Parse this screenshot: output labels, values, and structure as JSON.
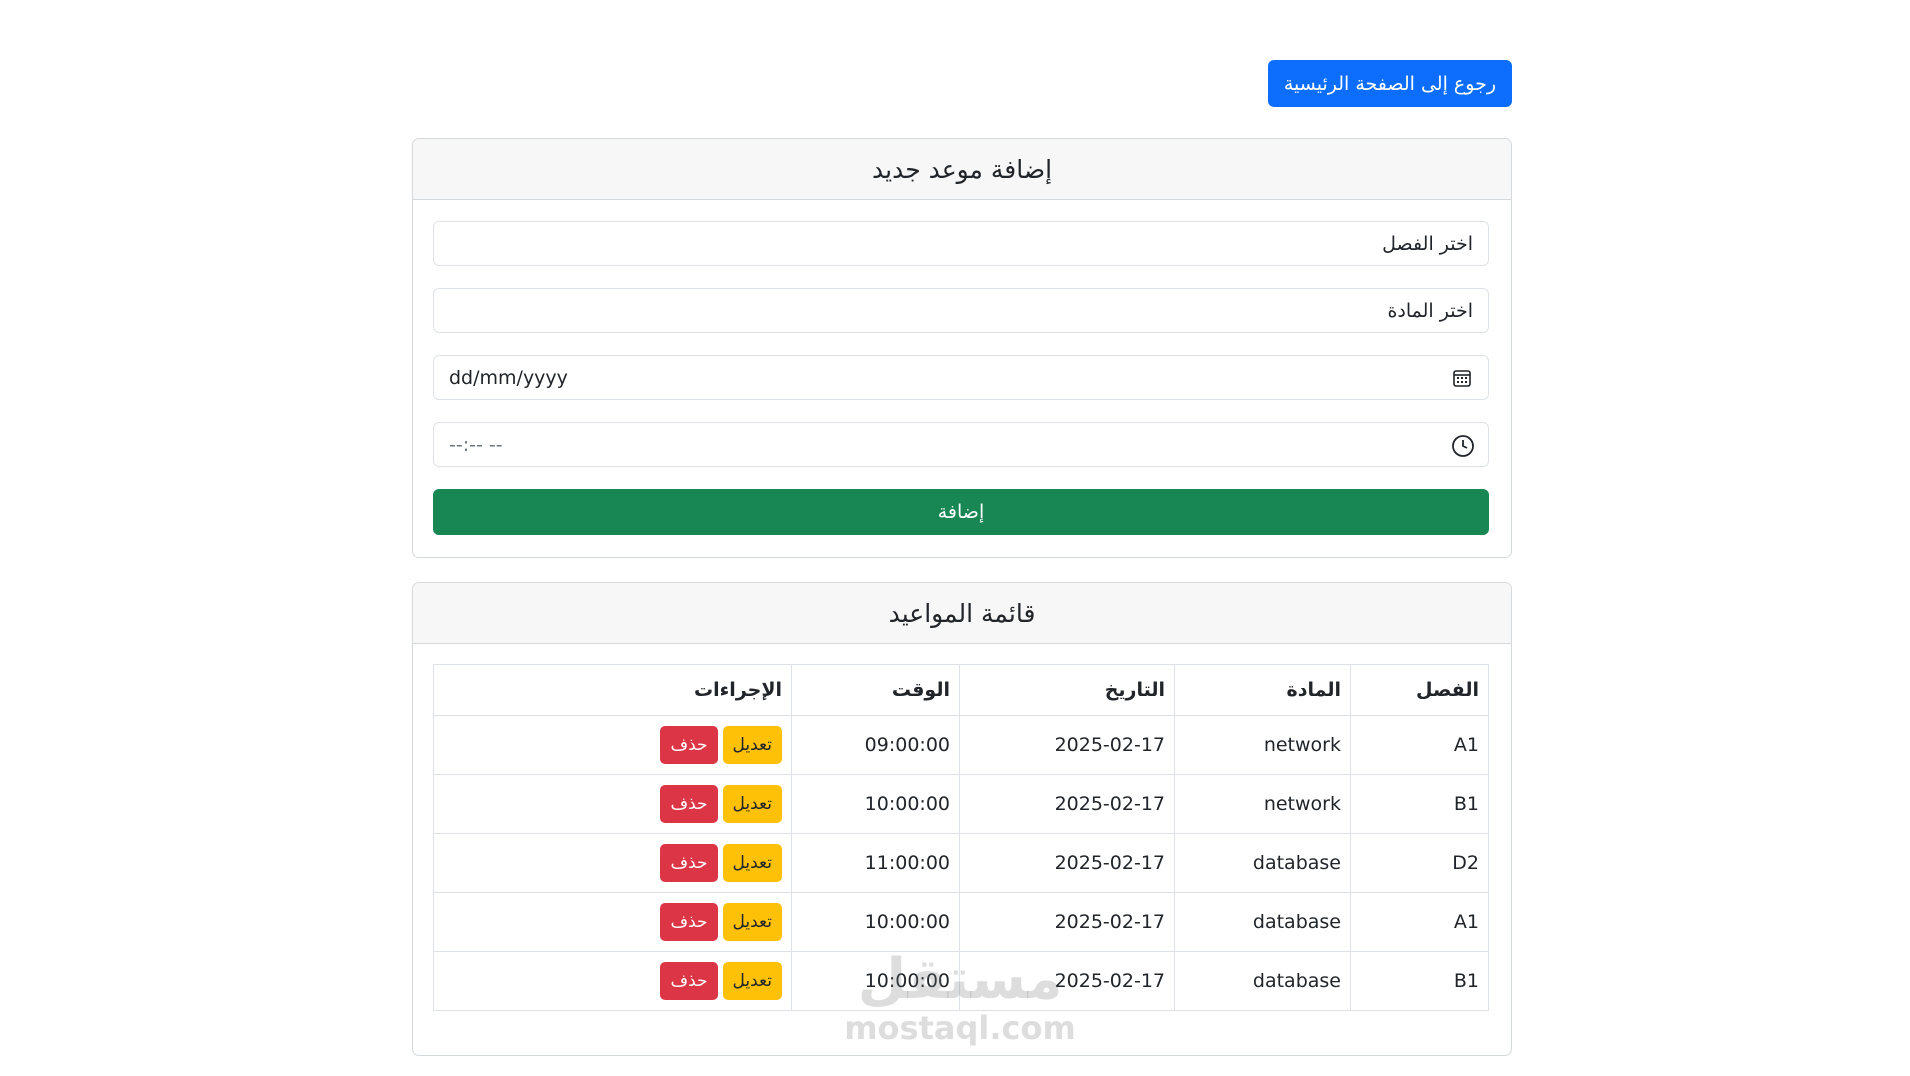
{
  "header": {
    "home_button_label": "رجوع إلى الصفحة الرئيسية"
  },
  "add_form": {
    "title": "إضافة موعد جديد",
    "class_select_placeholder": "اختر الفصل",
    "subject_select_placeholder": "اختر المادة",
    "date_placeholder": "dd/mm/yyyy",
    "time_placeholder": "--:-- --",
    "date_icon": "calendar-icon",
    "time_icon": "clock-icon",
    "submit_label": "إضافة",
    "submit_color": "#198754"
  },
  "schedule": {
    "title": "قائمة المواعيد",
    "columns": [
      "الفصل",
      "المادة",
      "التاريخ",
      "الوقت",
      "الإجراءات"
    ],
    "rows": [
      {
        "class": "A1",
        "subject": "network",
        "date": "2025-02-17",
        "time": "09:00:00"
      },
      {
        "class": "B1",
        "subject": "network",
        "date": "2025-02-17",
        "time": "10:00:00"
      },
      {
        "class": "D2",
        "subject": "database",
        "date": "2025-02-17",
        "time": "11:00:00"
      },
      {
        "class": "A1",
        "subject": "database",
        "date": "2025-02-17",
        "time": "10:00:00"
      },
      {
        "class": "B1",
        "subject": "database",
        "date": "2025-02-17",
        "time": "10:00:00"
      }
    ],
    "edit_label": "تعديل",
    "delete_label": "حذف",
    "edit_color": "#ffc107",
    "delete_color": "#dc3545"
  },
  "watermark": {
    "arabic": "مستقل",
    "latin": "mostaql.com"
  }
}
